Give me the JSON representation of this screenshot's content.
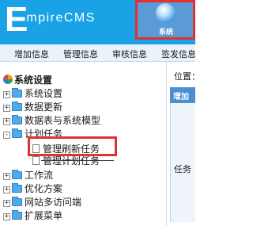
{
  "header": {
    "logo_big": "E",
    "logo_rest": "mpireCMS",
    "system_tile_label": "系统"
  },
  "nav": {
    "items": [
      "增加信息",
      "管理信息",
      "审核信息",
      "签发信息"
    ]
  },
  "sidebar": {
    "root_label": "系统设置",
    "items": [
      {
        "label": "系统设置",
        "state": "+"
      },
      {
        "label": "数据更新",
        "state": "+"
      },
      {
        "label": "数据表与系统模型",
        "state": "+"
      },
      {
        "label": "计划任务",
        "state": "-"
      },
      {
        "label": "管理刷新任务"
      },
      {
        "label": "管理计划任务"
      },
      {
        "label": "工作流",
        "state": "+"
      },
      {
        "label": "优化方案",
        "state": "+"
      },
      {
        "label": "网站多访问端",
        "state": "+"
      },
      {
        "label": "扩展菜单",
        "state": "+"
      }
    ]
  },
  "main": {
    "position_label": "位置：",
    "header_text": "增加",
    "task_label": "任务"
  }
}
